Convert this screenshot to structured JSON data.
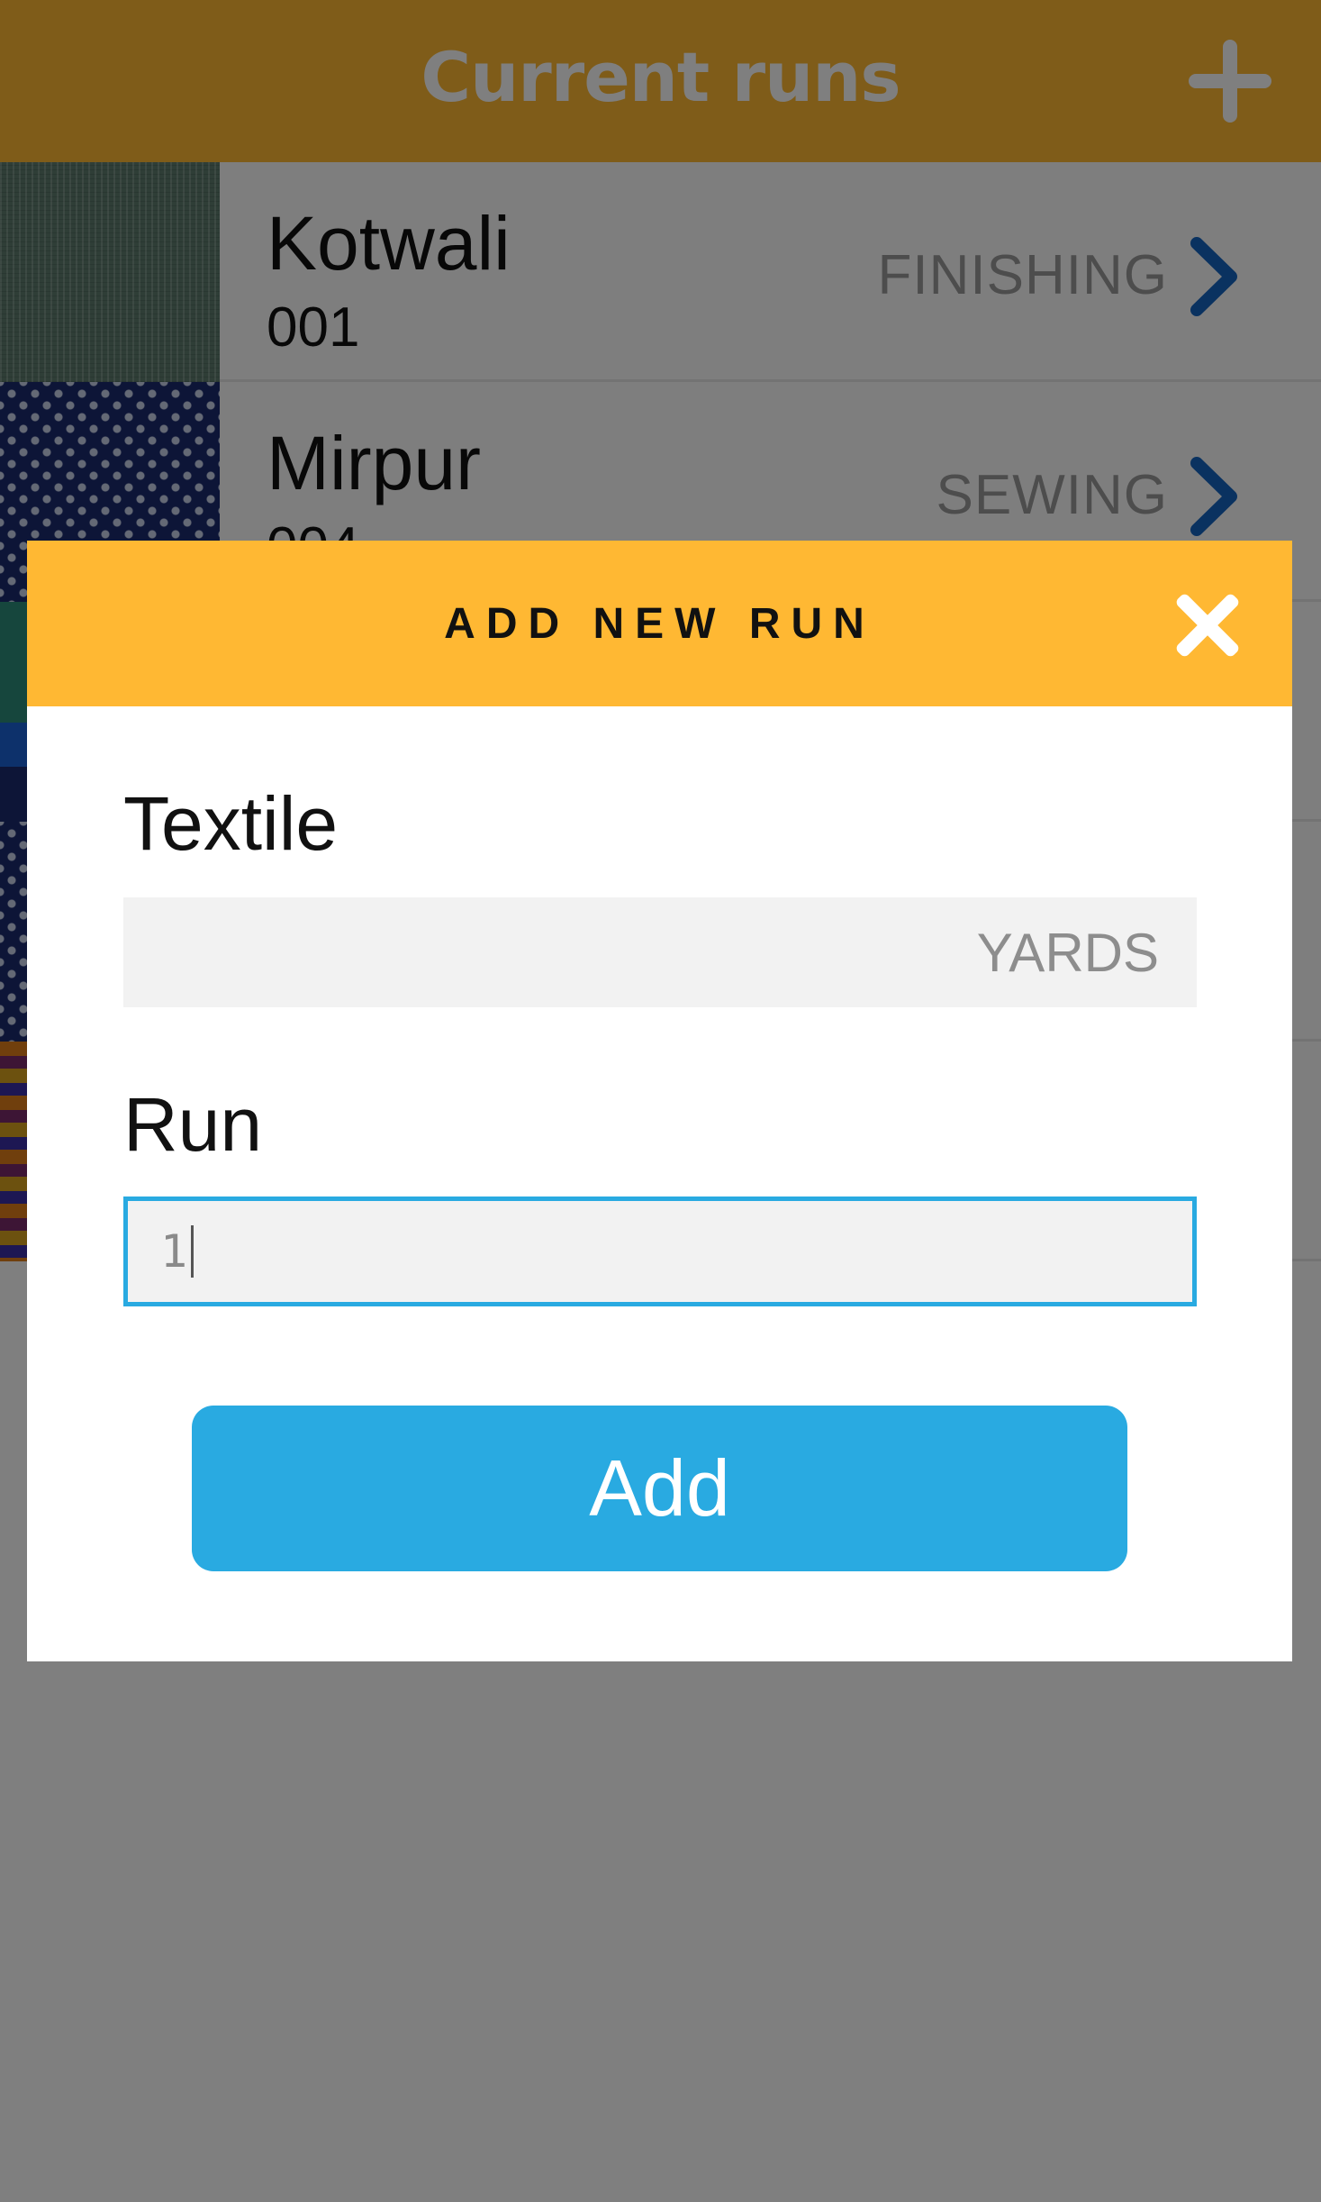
{
  "app_header": {
    "title": "Current runs",
    "add_icon": "plus-icon",
    "background": "#ffb833"
  },
  "runs": [
    {
      "name": "Kotwali",
      "number": "001",
      "status": "FINISHING",
      "swatch": "green-textile"
    },
    {
      "name": "Mirpur",
      "number": "004",
      "status": "SEWING",
      "swatch": "blue-droplet-textile"
    }
  ],
  "modal": {
    "title": "ADD NEW RUN",
    "close_icon": "close-icon",
    "textile_label": "Textile",
    "textile_value": "",
    "textile_unit": "YARDS",
    "run_label": "Run",
    "run_value": "1",
    "add_label": "Add",
    "accent": "#ffb833",
    "button_color": "#29aae1"
  }
}
